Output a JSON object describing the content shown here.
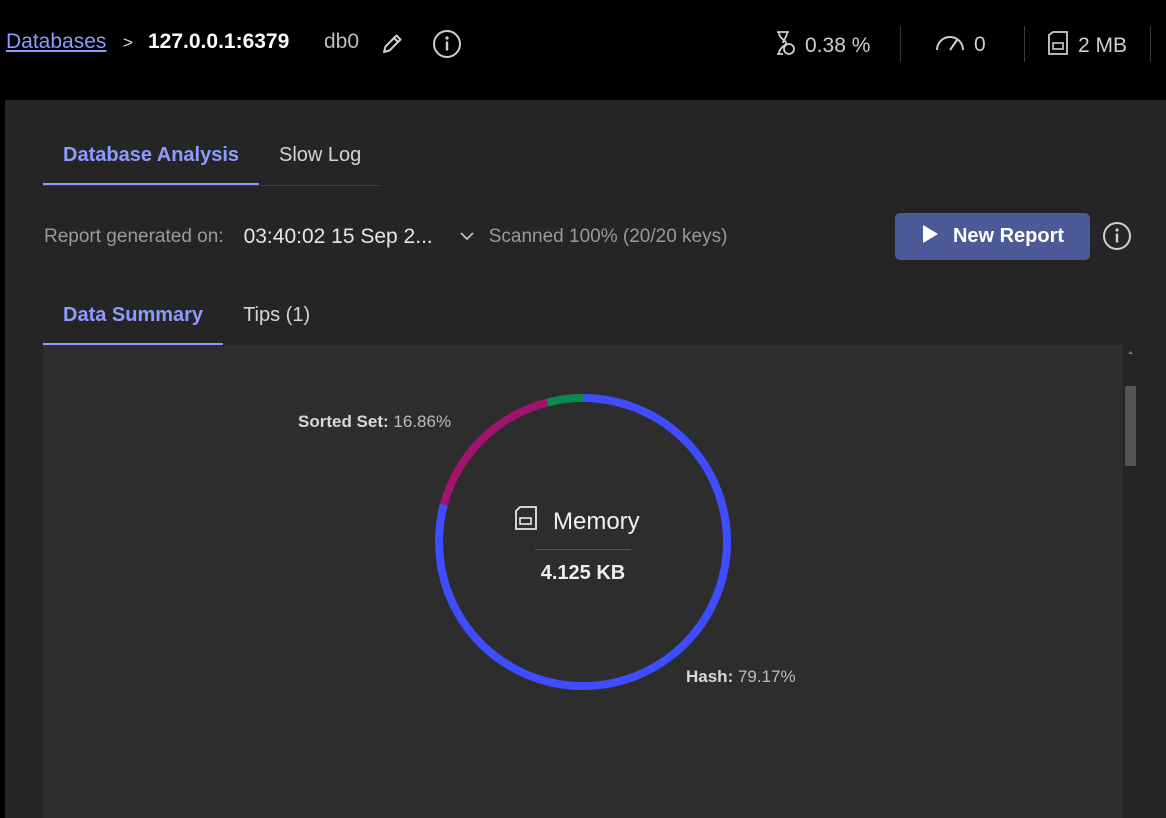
{
  "breadcrumb": {
    "databases_link": "Databases",
    "separator": ">",
    "host": "127.0.0.1:6379",
    "db_index": "db0"
  },
  "metrics": {
    "cpu": "0.38 %",
    "ops": "0",
    "memory": "2 MB"
  },
  "tabs": [
    {
      "label": "Database Analysis",
      "active": true
    },
    {
      "label": "Slow Log",
      "active": false
    }
  ],
  "report": {
    "generated_label": "Report generated on:",
    "generated_value": "03:40:02 15 Sep 2...",
    "scanned": "Scanned 100% (20/20 keys)",
    "new_report_label": "New Report"
  },
  "subtabs": [
    {
      "label": "Data Summary",
      "active": true
    },
    {
      "label": "Tips (1)",
      "active": false
    }
  ],
  "memory_chart": {
    "title": "Memory",
    "total": "4.125 KB",
    "label_sorted_set_name": "Sorted Set:",
    "label_sorted_set_value": "16.86%",
    "label_hash_name": "Hash:",
    "label_hash_value": "79.17%"
  },
  "chart_data": {
    "type": "pie",
    "title": "Memory",
    "total": "4.125 KB",
    "series": [
      {
        "name": "Hash",
        "value": 79.17,
        "color": "#3d4dff"
      },
      {
        "name": "Sorted Set",
        "value": 16.86,
        "color": "#a0146f"
      },
      {
        "name": "",
        "value": 3.97,
        "color": "#07894f"
      }
    ]
  },
  "colors": {
    "accent": "#8c9bff",
    "button": "#4c5b97",
    "panel": "#252525"
  }
}
